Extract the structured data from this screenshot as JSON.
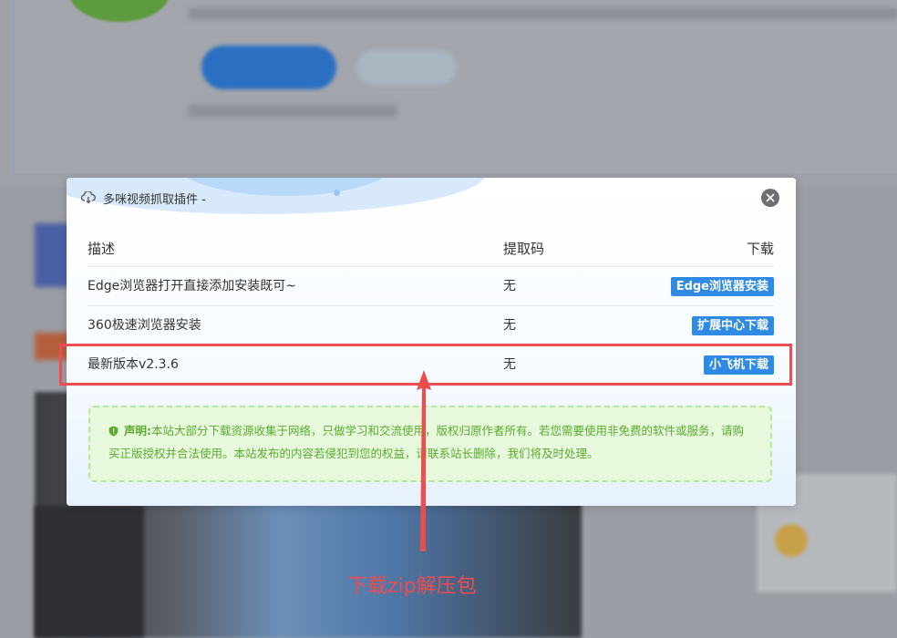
{
  "modal": {
    "title": "多咪视频抓取插件 -",
    "columns": {
      "desc": "描述",
      "code": "提取码",
      "download": "下载"
    },
    "rows": [
      {
        "desc": "Edge浏览器打开直接添加安装既可~",
        "code": "无",
        "button": "Edge浏览器安装"
      },
      {
        "desc": "360极速浏览器安装",
        "code": "无",
        "button": "扩展中心下载"
      },
      {
        "desc": "最新版本v2.3.6",
        "code": "无",
        "button": "小飞机下载"
      }
    ],
    "notice": {
      "title": "声明:",
      "text": "本站大部分下载资源收集于网络，只做学习和交流使用，版权归原作者所有。若您需要使用非免费的软件或服务，请购买正版授权并合法使用。本站发布的内容若侵犯到您的权益，请联系站长删除，我们将及时处理。"
    }
  },
  "annotation": {
    "label": "下载zip解压包",
    "color": "#ec4f51"
  },
  "colors": {
    "button": "#2f8ae3",
    "notice_text": "#5aab2e",
    "notice_border": "#b6e69b"
  }
}
